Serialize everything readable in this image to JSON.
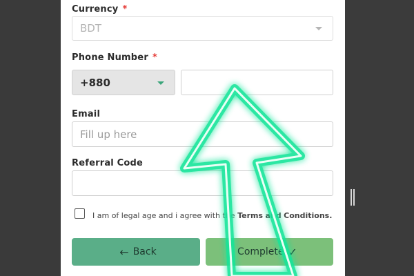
{
  "form": {
    "currency": {
      "label": "Currency",
      "required_mark": "*",
      "value": "BDT"
    },
    "phone": {
      "label": "Phone Number",
      "required_mark": "*",
      "dial_code": "+880",
      "value": ""
    },
    "email": {
      "label": "Email",
      "placeholder": "Fill up here"
    },
    "referral": {
      "label": "Referral Code",
      "value": ""
    },
    "agreement": {
      "text": "I am of legal age and i agree with",
      "link_fragment_1": "the",
      "terms": "Terms",
      "and": "and",
      "conditions": "Conditions."
    },
    "buttons": {
      "back": "Back",
      "complete": "Complete"
    }
  },
  "overlay": {
    "arrow_color": "#19e59a",
    "type": "green-neon-arrow-pointing-up"
  },
  "colors": {
    "back_button": "#5aae88",
    "complete_button": "#7cc07a",
    "required": "#e53935",
    "dial_caret": "#3aa57a"
  },
  "icons": {
    "currency_dropdown": "chevron-down-icon",
    "dial_dropdown": "chevron-down-icon",
    "back": "arrow-left-icon",
    "complete": "checkmark-icon"
  }
}
